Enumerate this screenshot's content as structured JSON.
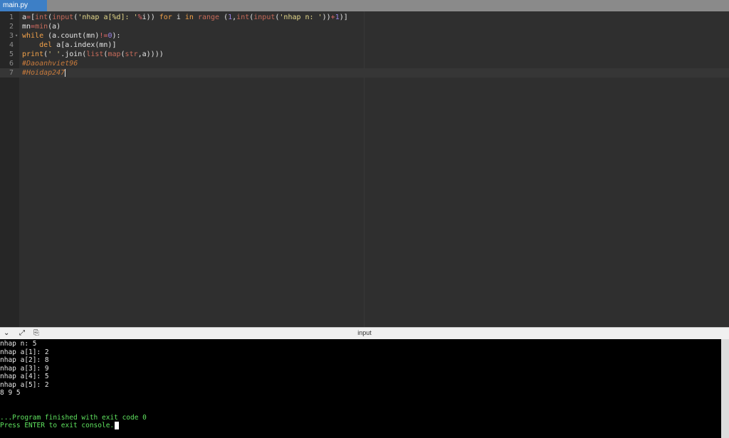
{
  "tab": {
    "filename": "main.py"
  },
  "editor": {
    "line_numbers": [
      "1",
      "2",
      "3",
      "4",
      "5",
      "6",
      "7"
    ],
    "fold_marker": "▾",
    "lines": [
      {
        "segments": [
          {
            "t": "a",
            "c": ""
          },
          {
            "t": "=",
            "c": "op"
          },
          {
            "t": "[",
            "c": ""
          },
          {
            "t": "int",
            "c": "fn"
          },
          {
            "t": "(",
            "c": ""
          },
          {
            "t": "input",
            "c": "fn"
          },
          {
            "t": "(",
            "c": ""
          },
          {
            "t": "'nhap a[%d]: '",
            "c": "str"
          },
          {
            "t": "%",
            "c": "op"
          },
          {
            "t": "i)) ",
            "c": ""
          },
          {
            "t": "for",
            "c": "kw"
          },
          {
            "t": " i ",
            "c": ""
          },
          {
            "t": "in",
            "c": "kw"
          },
          {
            "t": " ",
            "c": ""
          },
          {
            "t": "range",
            "c": "fn"
          },
          {
            "t": " (",
            "c": ""
          },
          {
            "t": "1",
            "c": "num"
          },
          {
            "t": ",",
            "c": ""
          },
          {
            "t": "int",
            "c": "fn"
          },
          {
            "t": "(",
            "c": ""
          },
          {
            "t": "input",
            "c": "fn"
          },
          {
            "t": "(",
            "c": ""
          },
          {
            "t": "'nhap n: '",
            "c": "str"
          },
          {
            "t": "))",
            "c": ""
          },
          {
            "t": "+",
            "c": "op"
          },
          {
            "t": "1",
            "c": "num"
          },
          {
            "t": ")]",
            "c": ""
          }
        ]
      },
      {
        "segments": [
          {
            "t": "mn",
            "c": ""
          },
          {
            "t": "=",
            "c": "op"
          },
          {
            "t": "min",
            "c": "fn"
          },
          {
            "t": "(a)",
            "c": ""
          }
        ]
      },
      {
        "segments": [
          {
            "t": "while",
            "c": "kw"
          },
          {
            "t": " (a.count(mn)",
            "c": ""
          },
          {
            "t": "!=",
            "c": "op"
          },
          {
            "t": "0",
            "c": "num"
          },
          {
            "t": "):",
            "c": ""
          }
        ]
      },
      {
        "segments": [
          {
            "t": "    ",
            "c": ""
          },
          {
            "t": "del",
            "c": "kw"
          },
          {
            "t": " a[a.index(mn)]",
            "c": ""
          }
        ]
      },
      {
        "segments": [
          {
            "t": "print",
            "c": "kw"
          },
          {
            "t": "(",
            "c": ""
          },
          {
            "t": "' '",
            "c": "str"
          },
          {
            "t": ".join(",
            "c": ""
          },
          {
            "t": "list",
            "c": "fn"
          },
          {
            "t": "(",
            "c": ""
          },
          {
            "t": "map",
            "c": "fn"
          },
          {
            "t": "(",
            "c": ""
          },
          {
            "t": "str",
            "c": "fn"
          },
          {
            "t": ",a))))",
            "c": ""
          }
        ]
      },
      {
        "segments": [
          {
            "t": "#Daoanhviet96",
            "c": "cm"
          }
        ]
      },
      {
        "segments": [
          {
            "t": "#Hoidap247",
            "c": "cm"
          }
        ]
      }
    ]
  },
  "panel": {
    "title": "input",
    "collapse_glyph": "⌄",
    "expand_glyph": "⤢",
    "copy_glyph": "⎘"
  },
  "console": {
    "lines": [
      "nhap n: 5",
      "nhap a[1]: 2",
      "nhap a[2]: 8",
      "nhap a[3]: 9",
      "nhap a[4]: 5",
      "nhap a[5]: 2",
      "8 9 5",
      "",
      "",
      ""
    ],
    "finished": "...Program finished with exit code 0",
    "press_enter": "Press ENTER to exit console."
  },
  "colors": {
    "tab_active": "#3d7fc6",
    "keyword": "#f2a24a",
    "function": "#c86b5a",
    "string": "#e6d98c",
    "number": "#9b84e4",
    "comment": "#c97b3c",
    "console_green": "#5fe35f"
  }
}
